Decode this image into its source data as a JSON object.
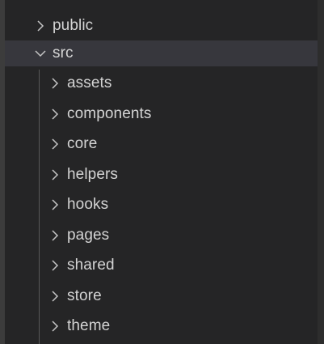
{
  "explorer": {
    "public_folder": {
      "label": "public",
      "expanded": false,
      "icon": "chevron-right-icon"
    },
    "src_folder": {
      "label": "src",
      "expanded": true,
      "icon": "chevron-down-icon",
      "children": [
        {
          "label": "assets",
          "icon": "chevron-right-icon"
        },
        {
          "label": "components",
          "icon": "chevron-right-icon"
        },
        {
          "label": "core",
          "icon": "chevron-right-icon"
        },
        {
          "label": "helpers",
          "icon": "chevron-right-icon"
        },
        {
          "label": "hooks",
          "icon": "chevron-right-icon"
        },
        {
          "label": "pages",
          "icon": "chevron-right-icon"
        },
        {
          "label": "shared",
          "icon": "chevron-right-icon"
        },
        {
          "label": "store",
          "icon": "chevron-right-icon"
        },
        {
          "label": "theme",
          "icon": "chevron-right-icon"
        }
      ]
    }
  },
  "colors": {
    "background": "#252526",
    "selected_row": "#37373d",
    "text": "#d4d4d4",
    "indent_guide": "#585858"
  }
}
